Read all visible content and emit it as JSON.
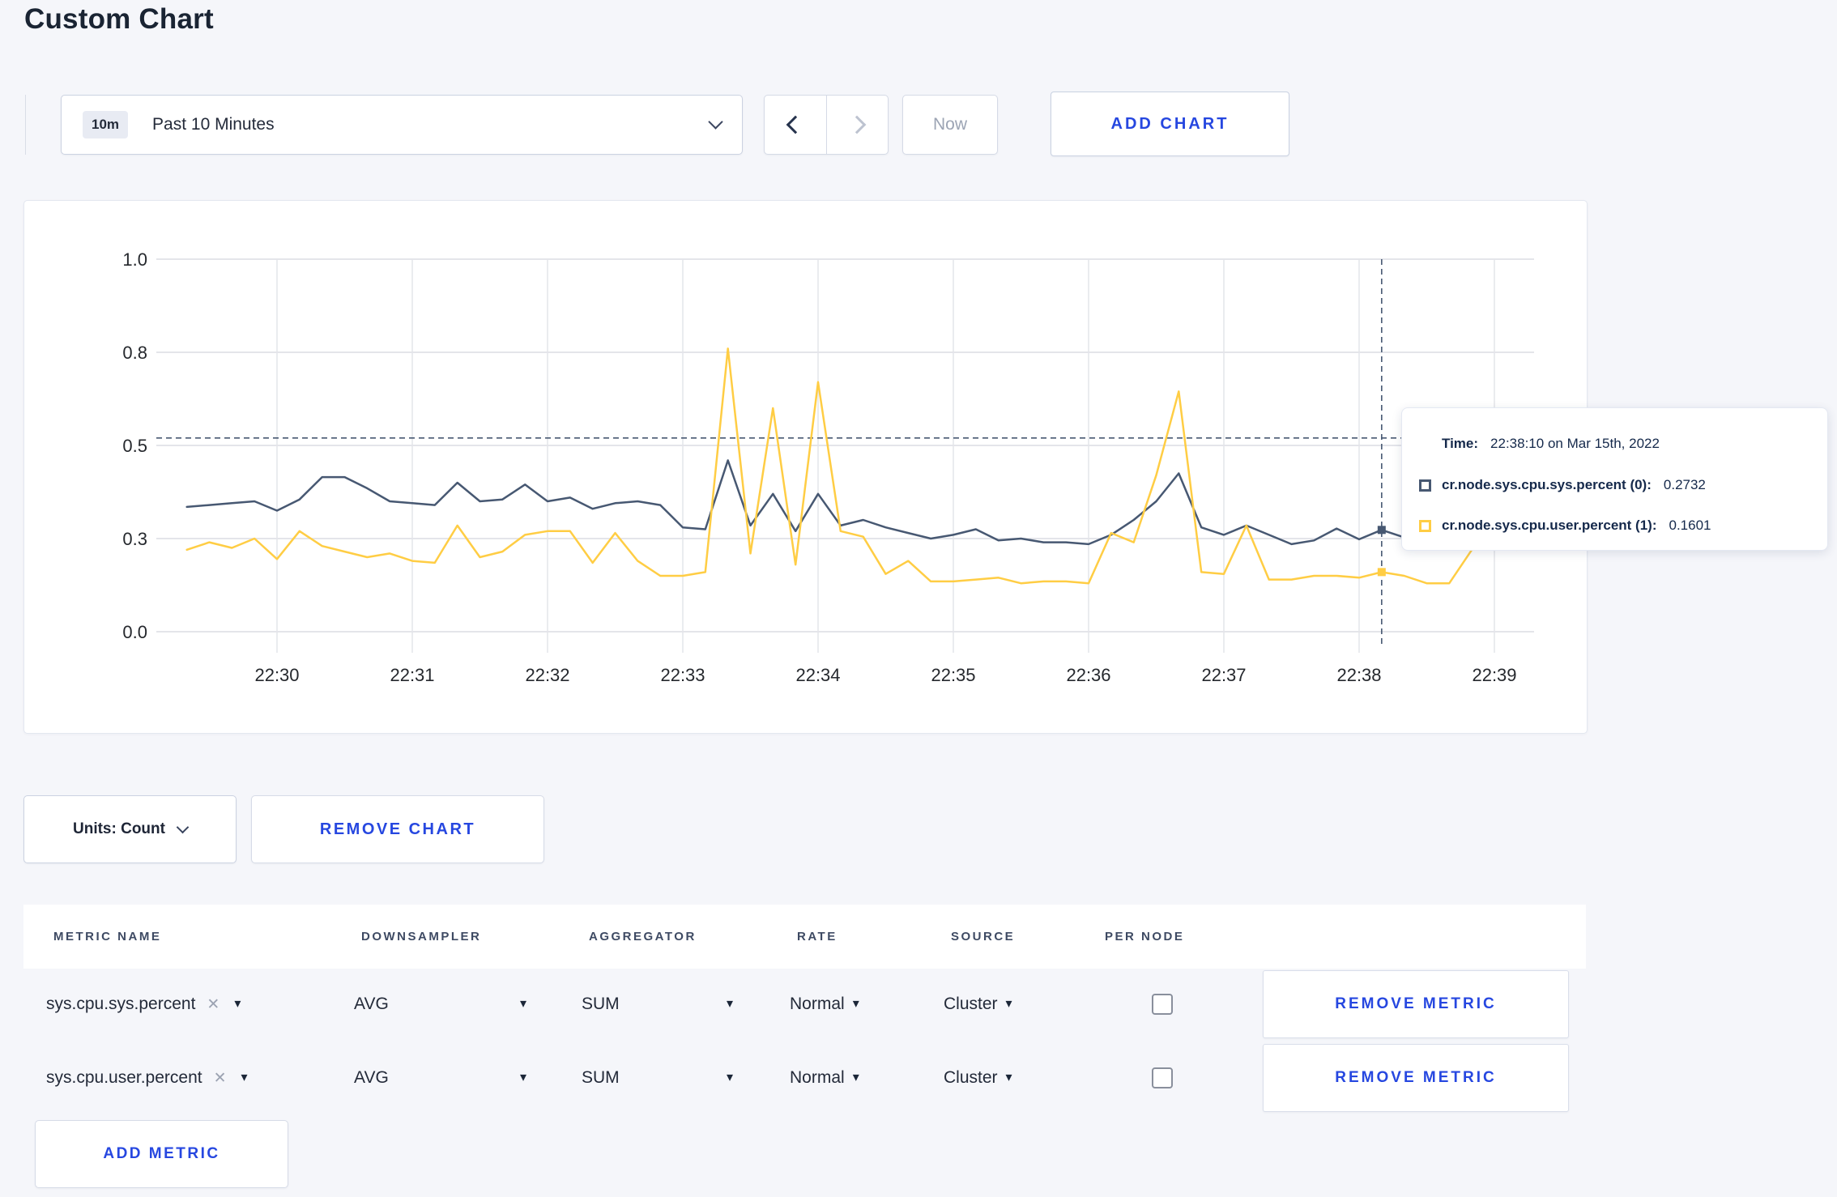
{
  "page": {
    "title": "Custom Chart"
  },
  "toolbar": {
    "timeframe": {
      "badge": "10m",
      "label": "Past 10 Minutes"
    },
    "now_label": "Now",
    "add_chart_label": "ADD CHART"
  },
  "icons": {
    "dropdown_caret": "▾",
    "clear": "✕"
  },
  "chart_data": {
    "type": "line",
    "ylim": [
      0,
      1
    ],
    "grid": true,
    "y_ticks": [
      {
        "v": 0,
        "label": "0.0"
      },
      {
        "v": 0.25,
        "label": "0.3"
      },
      {
        "v": 0.5,
        "label": "0.5"
      },
      {
        "v": 0.75,
        "label": "0.8"
      },
      {
        "v": 1,
        "label": "1.0"
      }
    ],
    "x_ticks": [
      {
        "t": 40,
        "label": "22:30"
      },
      {
        "t": 100,
        "label": "22:31"
      },
      {
        "t": 160,
        "label": "22:32"
      },
      {
        "t": 220,
        "label": "22:33"
      },
      {
        "t": 280,
        "label": "22:34"
      },
      {
        "t": 340,
        "label": "22:35"
      },
      {
        "t": 400,
        "label": "22:36"
      },
      {
        "t": 460,
        "label": "22:37"
      },
      {
        "t": 520,
        "label": "22:38"
      },
      {
        "t": 580,
        "label": "22:39"
      }
    ],
    "x_unit": "seconds since 22:29:20",
    "x": [
      0,
      10,
      20,
      30,
      40,
      50,
      60,
      70,
      80,
      90,
      100,
      110,
      120,
      130,
      140,
      150,
      160,
      170,
      180,
      190,
      200,
      210,
      220,
      230,
      240,
      250,
      260,
      270,
      280,
      290,
      300,
      310,
      320,
      330,
      340,
      350,
      360,
      370,
      380,
      390,
      400,
      410,
      420,
      430,
      440,
      450,
      460,
      470,
      480,
      490,
      500,
      510,
      520,
      530,
      540,
      550,
      560,
      570,
      580,
      590
    ],
    "series": [
      {
        "name": "cr.node.sys.cpu.sys.percent",
        "color": "#475872",
        "values": [
          0.335,
          0.34,
          0.345,
          0.35,
          0.325,
          0.355,
          0.415,
          0.415,
          0.385,
          0.35,
          0.345,
          0.34,
          0.4,
          0.35,
          0.355,
          0.395,
          0.35,
          0.36,
          0.33,
          0.345,
          0.35,
          0.34,
          0.28,
          0.275,
          0.46,
          0.285,
          0.37,
          0.27,
          0.37,
          0.285,
          0.3,
          0.28,
          0.265,
          0.25,
          0.26,
          0.275,
          0.245,
          0.25,
          0.24,
          0.24,
          0.235,
          0.26,
          0.3,
          0.35,
          0.425,
          0.28,
          0.26,
          0.285,
          0.26,
          0.235,
          0.245,
          0.277,
          0.248,
          0.2732,
          0.253,
          0.26,
          0.25,
          0.265,
          0.26,
          0.255
        ]
      },
      {
        "name": "cr.node.sys.cpu.user.percent",
        "color": "#FFCD44",
        "values": [
          0.22,
          0.24,
          0.225,
          0.25,
          0.195,
          0.27,
          0.23,
          0.215,
          0.2,
          0.21,
          0.19,
          0.185,
          0.285,
          0.2,
          0.215,
          0.26,
          0.27,
          0.27,
          0.185,
          0.265,
          0.19,
          0.15,
          0.15,
          0.16,
          0.76,
          0.21,
          0.6,
          0.18,
          0.67,
          0.27,
          0.255,
          0.155,
          0.19,
          0.135,
          0.135,
          0.14,
          0.145,
          0.13,
          0.135,
          0.135,
          0.13,
          0.265,
          0.24,
          0.42,
          0.645,
          0.16,
          0.155,
          0.285,
          0.14,
          0.14,
          0.15,
          0.15,
          0.145,
          0.1601,
          0.15,
          0.13,
          0.13,
          0.22,
          0.27,
          0.22
        ]
      }
    ],
    "crosshair": {
      "time_s": 530,
      "hline_value": 0.52,
      "values": [
        0.2732,
        0.1601
      ]
    }
  },
  "tooltip": {
    "time_label": "Time:",
    "time_value": "22:38:10 on Mar 15th, 2022",
    "rows": [
      {
        "name": "cr.node.sys.cpu.sys.percent (0):",
        "value": "0.2732",
        "color": "#475872"
      },
      {
        "name": "cr.node.sys.cpu.user.percent (1):",
        "value": "0.1601",
        "color": "#FFCD44"
      }
    ]
  },
  "chart_controls": {
    "units_label": "Units: Count",
    "remove_chart_label": "REMOVE CHART"
  },
  "metrics_table": {
    "headers": [
      "METRIC NAME",
      "DOWNSAMPLER",
      "AGGREGATOR",
      "RATE",
      "SOURCE",
      "PER NODE"
    ],
    "rows": [
      {
        "metric": "sys.cpu.sys.percent",
        "downsampler": "AVG",
        "aggregator": "SUM",
        "rate": "Normal",
        "source": "Cluster",
        "per_node": false,
        "remove_label": "REMOVE METRIC"
      },
      {
        "metric": "sys.cpu.user.percent",
        "downsampler": "AVG",
        "aggregator": "SUM",
        "rate": "Normal",
        "source": "Cluster",
        "per_node": false,
        "remove_label": "REMOVE METRIC"
      }
    ],
    "add_metric_label": "ADD METRIC"
  }
}
